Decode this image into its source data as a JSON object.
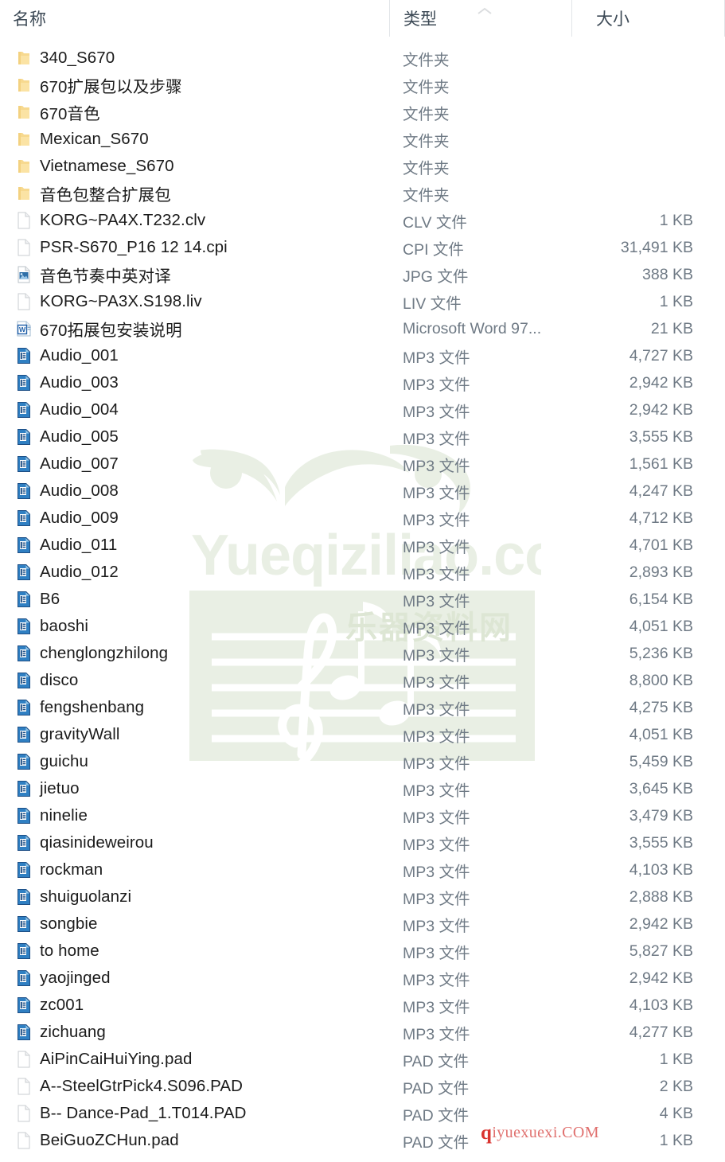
{
  "header": {
    "columns": [
      {
        "key": "name",
        "label": "名称"
      },
      {
        "key": "type",
        "label": "类型"
      },
      {
        "key": "size",
        "label": "大小"
      }
    ],
    "sort_indicator": "chevron-up-icon"
  },
  "watermark": {
    "center_text": "Yueqiziliao.com",
    "center_subtext": "乐器资料网",
    "bottom_prefix": "q",
    "bottom_text": "iyuexuexi.COM",
    "bottom_color": "#e0706e"
  },
  "rows": [
    {
      "icon": "folder-icon",
      "name": "340_S670",
      "type": "文件夹",
      "size": ""
    },
    {
      "icon": "folder-icon",
      "name": "670扩展包以及步骤",
      "type": "文件夹",
      "size": ""
    },
    {
      "icon": "folder-icon",
      "name": "670音色",
      "type": "文件夹",
      "size": ""
    },
    {
      "icon": "folder-icon",
      "name": "Mexican_S670",
      "type": "文件夹",
      "size": ""
    },
    {
      "icon": "folder-icon",
      "name": "Vietnamese_S670",
      "type": "文件夹",
      "size": ""
    },
    {
      "icon": "folder-icon",
      "name": "音色包整合扩展包",
      "type": "文件夹",
      "size": ""
    },
    {
      "icon": "generic-file-icon",
      "name": "KORG~PA4X.T232.clv",
      "type": "CLV 文件",
      "size": "1 KB"
    },
    {
      "icon": "generic-file-icon",
      "name": "PSR-S670_P16 12 14.cpi",
      "type": "CPI 文件",
      "size": "31,491 KB"
    },
    {
      "icon": "image-file-icon",
      "name": "音色节奏中英对译",
      "type": "JPG 文件",
      "size": "388 KB"
    },
    {
      "icon": "generic-file-icon",
      "name": "KORG~PA3X.S198.liv",
      "type": "LIV 文件",
      "size": "1 KB"
    },
    {
      "icon": "word-file-icon",
      "name": "670拓展包安装说明",
      "type": "Microsoft Word 97...",
      "size": "21 KB"
    },
    {
      "icon": "media-file-icon",
      "name": "Audio_001",
      "type": "MP3 文件",
      "size": "4,727 KB"
    },
    {
      "icon": "media-file-icon",
      "name": "Audio_003",
      "type": "MP3 文件",
      "size": "2,942 KB"
    },
    {
      "icon": "media-file-icon",
      "name": "Audio_004",
      "type": "MP3 文件",
      "size": "2,942 KB"
    },
    {
      "icon": "media-file-icon",
      "name": "Audio_005",
      "type": "MP3 文件",
      "size": "3,555 KB"
    },
    {
      "icon": "media-file-icon",
      "name": "Audio_007",
      "type": "MP3 文件",
      "size": "1,561 KB"
    },
    {
      "icon": "media-file-icon",
      "name": "Audio_008",
      "type": "MP3 文件",
      "size": "4,247 KB"
    },
    {
      "icon": "media-file-icon",
      "name": "Audio_009",
      "type": "MP3 文件",
      "size": "4,712 KB"
    },
    {
      "icon": "media-file-icon",
      "name": "Audio_011",
      "type": "MP3 文件",
      "size": "4,701 KB"
    },
    {
      "icon": "media-file-icon",
      "name": "Audio_012",
      "type": "MP3 文件",
      "size": "2,893 KB"
    },
    {
      "icon": "media-file-icon",
      "name": "B6",
      "type": "MP3 文件",
      "size": "6,154 KB"
    },
    {
      "icon": "media-file-icon",
      "name": "baoshi",
      "type": "MP3 文件",
      "size": "4,051 KB"
    },
    {
      "icon": "media-file-icon",
      "name": "chenglongzhilong",
      "type": "MP3 文件",
      "size": "5,236 KB"
    },
    {
      "icon": "media-file-icon",
      "name": "disco",
      "type": "MP3 文件",
      "size": "8,800 KB"
    },
    {
      "icon": "media-file-icon",
      "name": "fengshenbang",
      "type": "MP3 文件",
      "size": "4,275 KB"
    },
    {
      "icon": "media-file-icon",
      "name": "gravityWall",
      "type": "MP3 文件",
      "size": "4,051 KB"
    },
    {
      "icon": "media-file-icon",
      "name": "guichu",
      "type": "MP3 文件",
      "size": "5,459 KB"
    },
    {
      "icon": "media-file-icon",
      "name": "jietuo",
      "type": "MP3 文件",
      "size": "3,645 KB"
    },
    {
      "icon": "media-file-icon",
      "name": "ninelie",
      "type": "MP3 文件",
      "size": "3,479 KB"
    },
    {
      "icon": "media-file-icon",
      "name": "qiasinideweirou",
      "type": "MP3 文件",
      "size": "3,555 KB"
    },
    {
      "icon": "media-file-icon",
      "name": "rockman",
      "type": "MP3 文件",
      "size": "4,103 KB"
    },
    {
      "icon": "media-file-icon",
      "name": "shuiguolanzi",
      "type": "MP3 文件",
      "size": "2,888 KB"
    },
    {
      "icon": "media-file-icon",
      "name": "songbie",
      "type": "MP3 文件",
      "size": "2,942 KB"
    },
    {
      "icon": "media-file-icon",
      "name": "to home",
      "type": "MP3 文件",
      "size": "5,827 KB"
    },
    {
      "icon": "media-file-icon",
      "name": "yaojinged",
      "type": "MP3 文件",
      "size": "2,942 KB"
    },
    {
      "icon": "media-file-icon",
      "name": "zc001",
      "type": "MP3 文件",
      "size": "4,103 KB"
    },
    {
      "icon": "media-file-icon",
      "name": "zichuang",
      "type": "MP3 文件",
      "size": "4,277 KB"
    },
    {
      "icon": "generic-file-icon",
      "name": "AiPinCaiHuiYing.pad",
      "type": "PAD 文件",
      "size": "1 KB"
    },
    {
      "icon": "generic-file-icon",
      "name": "A--SteelGtrPick4.S096.PAD",
      "type": "PAD 文件",
      "size": "2 KB"
    },
    {
      "icon": "generic-file-icon",
      "name": "B-- Dance-Pad_1.T014.PAD",
      "type": "PAD 文件",
      "size": "4 KB"
    },
    {
      "icon": "generic-file-icon",
      "name": "BeiGuoZCHun.pad",
      "type": "PAD 文件",
      "size": "1 KB"
    }
  ]
}
